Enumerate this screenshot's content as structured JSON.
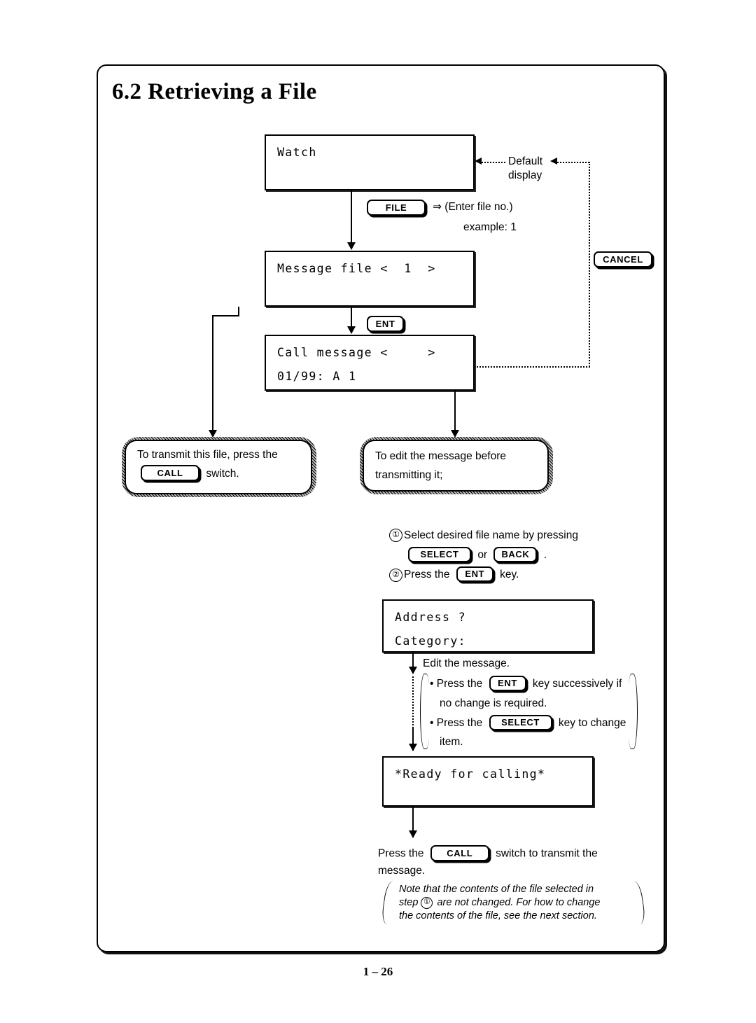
{
  "page": {
    "section_title": "6.2 Retrieving a File",
    "page_number": "1 – 26"
  },
  "displays": {
    "watch": {
      "line1": "Watch",
      "line2": ""
    },
    "msgfile": {
      "line1": "Message file <  1  >",
      "line2": ""
    },
    "callmsg": {
      "line1": "Call message <     >",
      "line2": "01/99: A 1"
    },
    "address": {
      "line1": "Address ?",
      "line2": "Category:"
    },
    "ready": {
      "line1": "*Ready for calling*",
      "line2": ""
    }
  },
  "keys": {
    "file": "FILE",
    "ent": "ENT",
    "cancel": "CANCEL",
    "call": "CALL",
    "select": "SELECT",
    "back": "BACK"
  },
  "annotations": {
    "default_display_line1": "Default",
    "default_display_line2": "display",
    "enter_file_no": "⇒ (Enter file no.)",
    "example": "example: 1"
  },
  "callouts": {
    "left_line1": "To transmit this file, press the",
    "left_line2_suffix": "switch.",
    "right_line1": "To edit the message before",
    "right_line2": "transmitting it;"
  },
  "steps": {
    "num1": "①",
    "num2": "②",
    "step1_text": "Select desired file name by pressing",
    "step1_or": "or",
    "step1_period": ".",
    "step2_prefix": "Press the",
    "step2_suffix": "key."
  },
  "edit_block": {
    "heading": "Edit the message.",
    "bullet1_prefix": "• Press the",
    "bullet1_suffix": "key successively if",
    "bullet1_line2": "no change is required.",
    "bullet2_prefix": "• Press the",
    "bullet2_suffix": "key to change",
    "bullet2_line2": "item."
  },
  "transmit": {
    "prefix": "Press the",
    "suffix": "switch to transmit the",
    "line2": "message."
  },
  "final_note": {
    "line1": "Note that the contents of the file selected in",
    "line2_a": "step",
    "line2_num": "①",
    "line2_b": "are not changed. For how to change",
    "line3": "the contents of the file, see the next section."
  }
}
